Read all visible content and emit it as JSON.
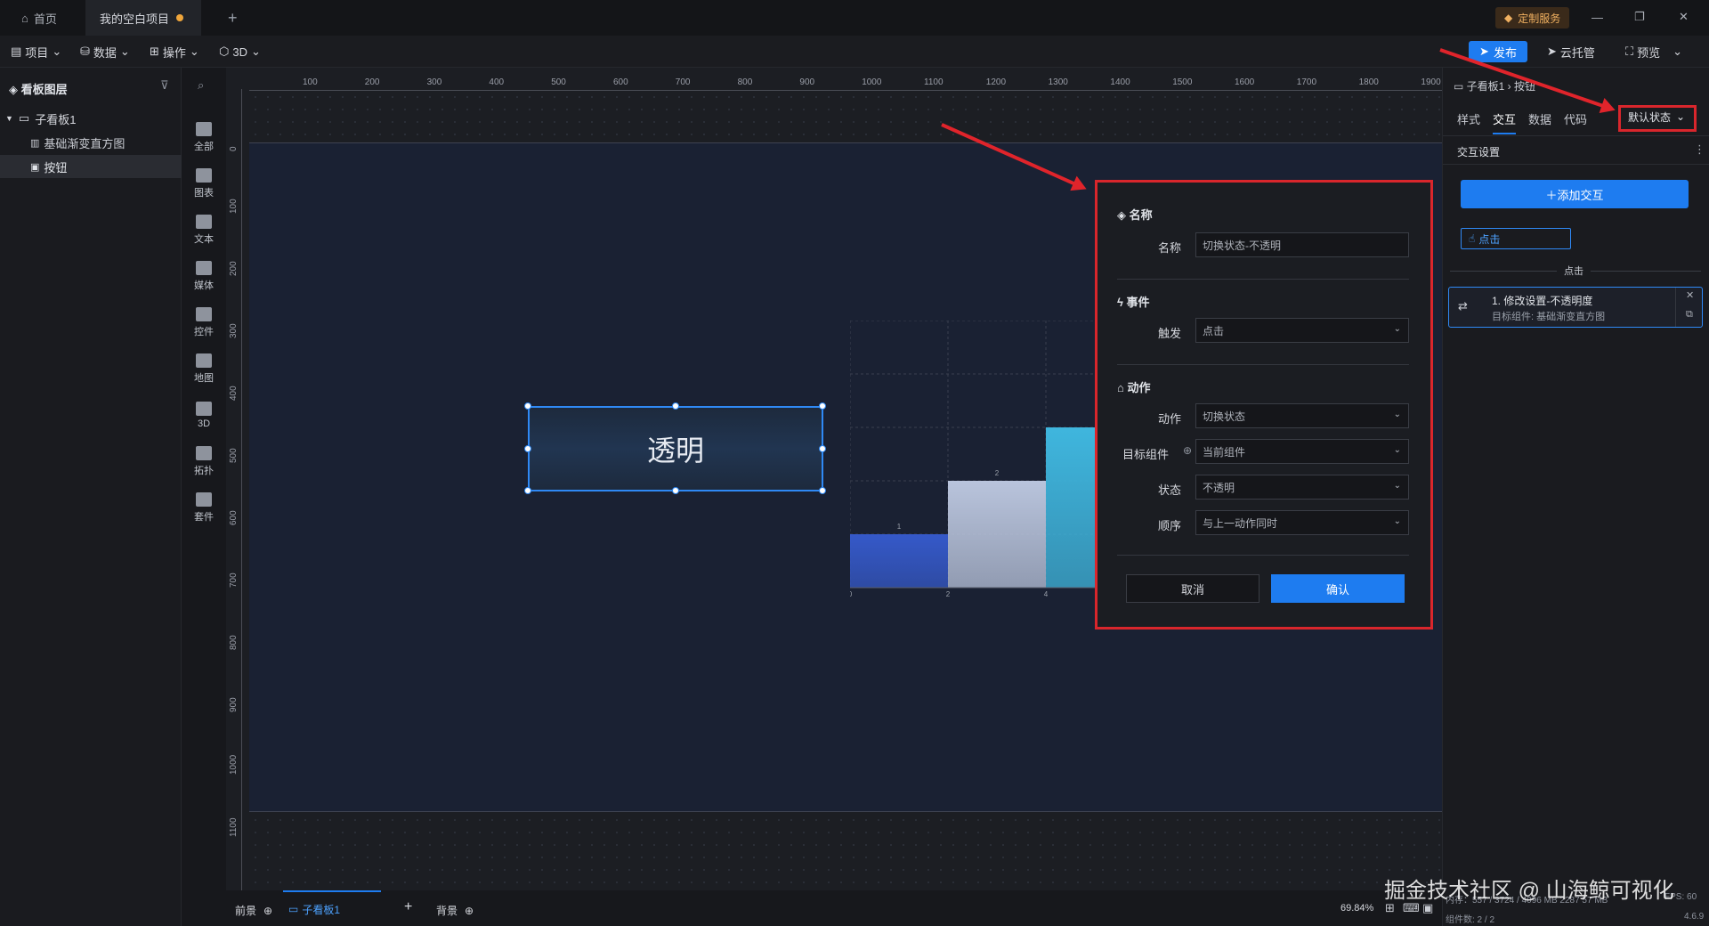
{
  "tabs": {
    "home": "首页",
    "project": "我的空白项目",
    "add": "+"
  },
  "titlebar": {
    "service": "定制服务",
    "min": "—",
    "restore": "❐",
    "close": "✕"
  },
  "menubar": {
    "project": "项目",
    "data": "数据",
    "operate": "操作",
    "three_d": "3D",
    "publish": "发布",
    "cloud": "云托管",
    "preview": "预览"
  },
  "layers": {
    "title": "看板图层",
    "board": "子看板1",
    "item1": "基础渐变直方图",
    "item2": "按钮"
  },
  "iconbar": [
    "全部",
    "图表",
    "文本",
    "媒体",
    "控件",
    "地图",
    "3D",
    "拓扑",
    "套件"
  ],
  "ruler_top": [
    "100",
    "200",
    "300",
    "400",
    "500",
    "600",
    "700",
    "800",
    "900",
    "1000",
    "1100",
    "1200",
    "1300",
    "1400",
    "1500",
    "1600",
    "1700",
    "1800",
    "1900"
  ],
  "ruler_left": [
    "0",
    "100",
    "200",
    "300",
    "400",
    "500",
    "600",
    "700",
    "800",
    "900",
    "1000",
    "1100"
  ],
  "canvas": {
    "button_text": "透明"
  },
  "chart_data": {
    "type": "bar",
    "x_ticks": [
      "0",
      "2",
      "4"
    ],
    "bars": [
      {
        "x": 1,
        "value": 1,
        "label": "1"
      },
      {
        "x": 3,
        "value": 2,
        "label": "2"
      },
      {
        "x": 5,
        "value": 3,
        "label": ""
      }
    ],
    "colors": [
      "#3559c9",
      "#b9c4dc",
      "#3fb6de"
    ]
  },
  "dialog": {
    "name_section": "名称",
    "name_label": "名称",
    "name_placeholder": "切换状态-不透明",
    "event_section": "事件",
    "trigger_label": "触发",
    "trigger_value": "点击",
    "action_section": "动作",
    "action_label": "动作",
    "action_value": "切换状态",
    "target_label": "目标组件",
    "target_value": "当前组件",
    "state_label": "状态",
    "state_value": "不透明",
    "order_label": "顺序",
    "order_value": "与上一动作同时",
    "cancel": "取消",
    "confirm": "确认"
  },
  "right": {
    "breadcrumb": "子看板1 › 按钮",
    "tabs": [
      "样式",
      "交互",
      "数据",
      "代码"
    ],
    "state_select": "默认状态",
    "interaction_title": "交互设置",
    "add_interaction": "＋添加交互",
    "click_tag": "点击",
    "group_label": "点击",
    "item_title": "1. 修改设置-不透明度",
    "item_sub": "目标组件: 基础渐变直方图"
  },
  "bottom": {
    "front": "前景",
    "board_tab": "子看板1",
    "add": "+",
    "background": "背景",
    "zoom": "69.84%",
    "stats": "内存：557 / 3724 / 4096 MB  2287 57 MB",
    "fps": "FPS: 60",
    "count": "组件数: 2 / 2",
    "version": "4.6.9"
  },
  "watermark": "掘金技术社区 @ 山海鲸可视化",
  "colors": {
    "accent": "#1e7cf0",
    "annotation": "#d9262c"
  }
}
